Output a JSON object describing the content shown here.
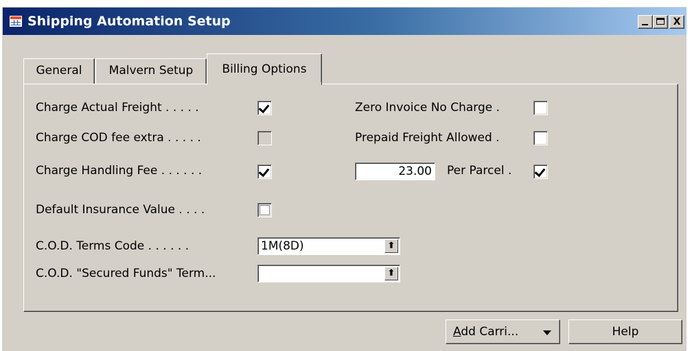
{
  "window": {
    "title": "Shipping Automation Setup",
    "icon": "table-form-icon",
    "controls": {
      "minimize": "_",
      "maximize": "□",
      "close": "X"
    }
  },
  "tabs": [
    {
      "label": "General",
      "active": false
    },
    {
      "label": "Malvern Setup",
      "active": false
    },
    {
      "label": "Billing Options",
      "active": true
    }
  ],
  "billing": {
    "charge_actual_freight": {
      "label": "Charge Actual Freight . . . . .",
      "checked": true
    },
    "charge_cod_fee_extra": {
      "label": "Charge COD fee extra . . . . .",
      "checked": false,
      "disabled": true
    },
    "charge_handling_fee": {
      "label": "Charge Handling Fee . . . . . .",
      "checked": true
    },
    "default_insurance_value": {
      "label": "Default Insurance Value . . . .",
      "checked": false
    },
    "cod_terms_code": {
      "label": "C.O.D. Terms Code . . . . . .",
      "value": "1M(8D)"
    },
    "cod_secured_funds_term": {
      "label": "C.O.D. \"Secured Funds\" Term...",
      "value": ""
    },
    "zero_invoice_no_charge": {
      "label": "Zero Invoice No Charge .",
      "checked": false
    },
    "prepaid_freight_allowed": {
      "label": "Prepaid Freight Allowed .",
      "checked": false
    },
    "handling_fee_amount": {
      "value": "23.00"
    },
    "per_parcel": {
      "label": "Per Parcel .",
      "checked": true
    }
  },
  "buttons": {
    "add_carrier": {
      "underline": "A",
      "rest": "dd Carri..."
    },
    "help": "Help"
  },
  "lookup_glyph": "⬆"
}
